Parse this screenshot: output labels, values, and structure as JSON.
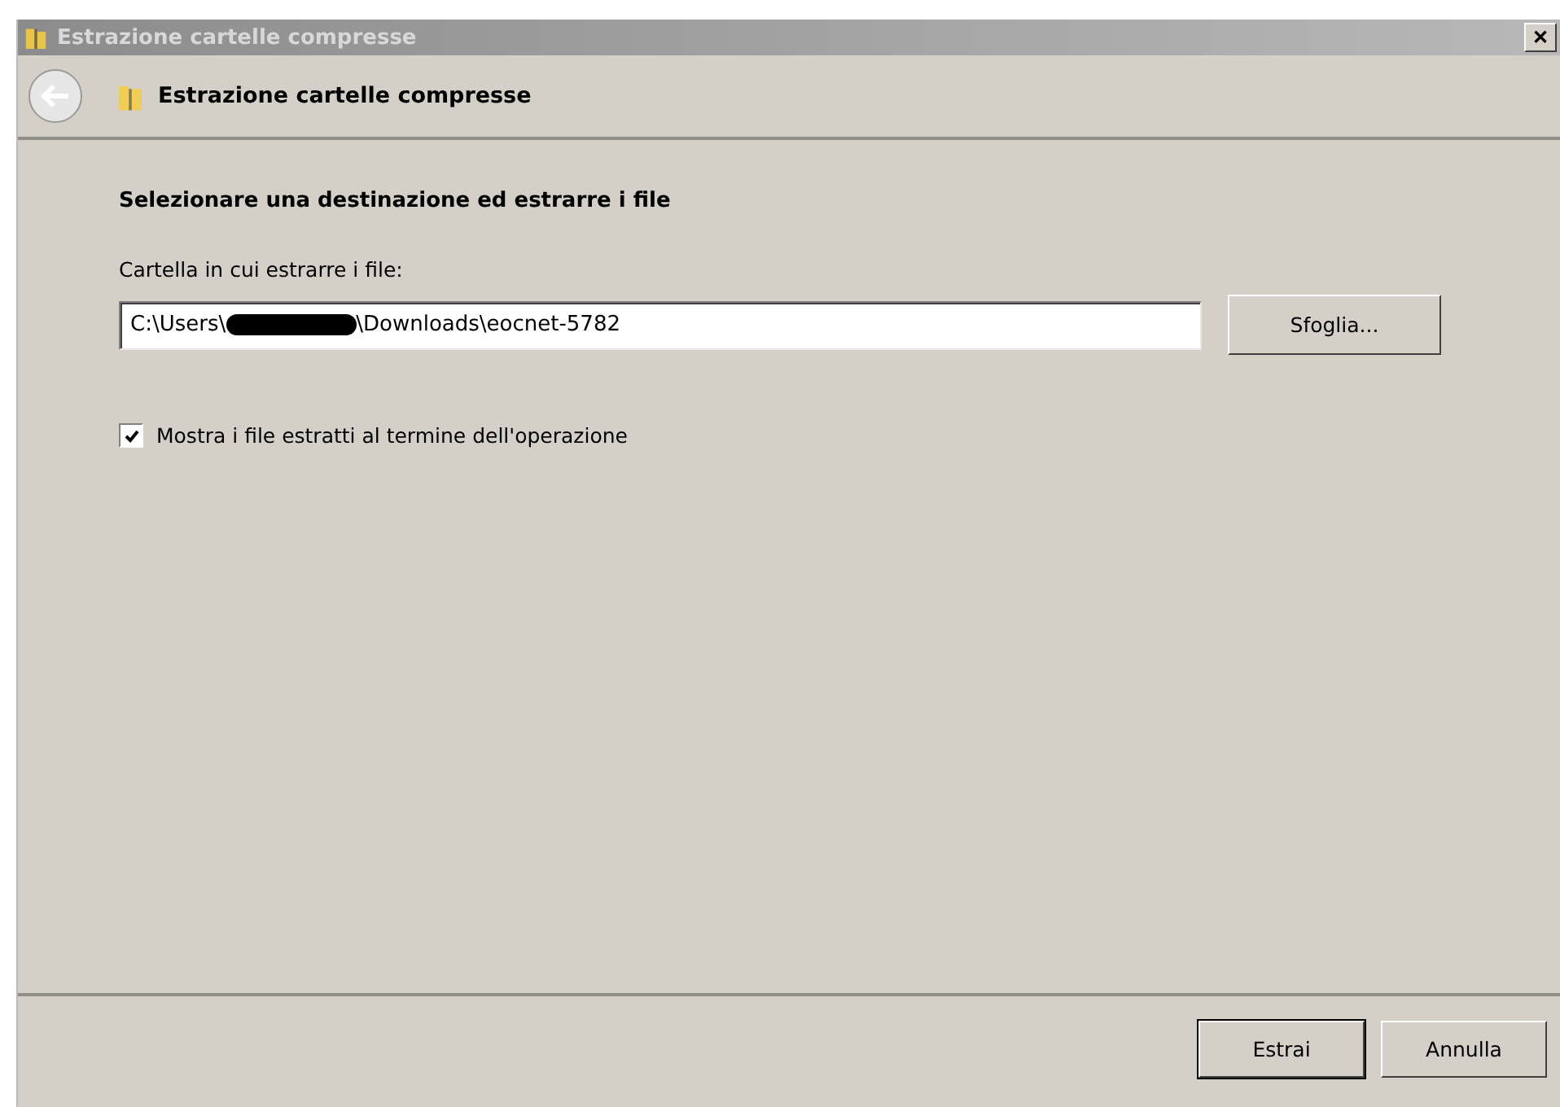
{
  "window": {
    "title": "Estrazione cartelle compresse",
    "close": "✕"
  },
  "header": {
    "title": "Estrazione cartelle compresse"
  },
  "content": {
    "heading": "Selezionare una destinazione ed estrarre i file",
    "field_label": "Cartella in cui estrarre i file:",
    "path": {
      "before": "C:\\Users\\",
      "after": "\\Downloads\\eocnet-5782"
    },
    "browse_button": "Sfoglia...",
    "show_files": {
      "label": "Mostra i file estratti al termine dell'operazione",
      "checked": true
    }
  },
  "buttons": [
    {
      "label": "Estrai",
      "default": true
    },
    {
      "label": "Annulla",
      "default": false
    }
  ]
}
